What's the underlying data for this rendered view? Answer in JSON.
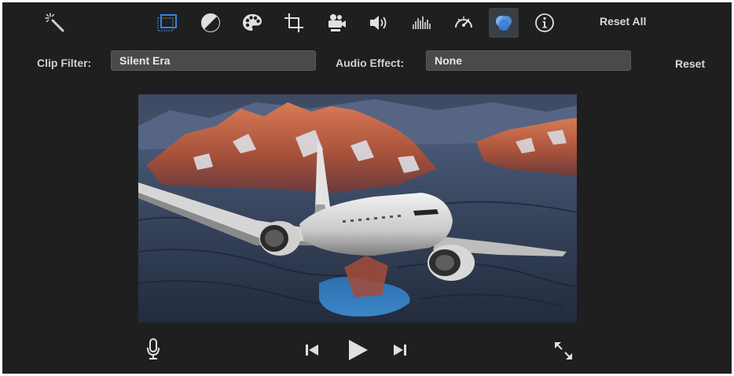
{
  "toolbar": {
    "tools": [
      {
        "id": "magic-wand",
        "icon": "magic-wand-icon"
      },
      {
        "id": "crop-frame",
        "icon": "crop-frame-icon",
        "state": "selected"
      },
      {
        "id": "color-balance",
        "icon": "color-balance-icon"
      },
      {
        "id": "color-correction",
        "icon": "palette-icon"
      },
      {
        "id": "crop",
        "icon": "crop-icon"
      },
      {
        "id": "stabilization",
        "icon": "video-camera-icon"
      },
      {
        "id": "volume",
        "icon": "speaker-icon"
      },
      {
        "id": "noise-reduction",
        "icon": "equalizer-icon"
      },
      {
        "id": "speed",
        "icon": "speedometer-icon"
      },
      {
        "id": "clip-filter",
        "icon": "filter-circles-icon",
        "state": "active"
      },
      {
        "id": "info",
        "icon": "info-icon"
      }
    ],
    "reset_all_label": "Reset All"
  },
  "filters": {
    "clip_filter_label": "Clip Filter:",
    "clip_filter_value": "Silent Era",
    "audio_effect_label": "Audio Effect:",
    "audio_effect_value": "None",
    "reset_label": "Reset"
  },
  "playback": {
    "controls": [
      "microphone-icon",
      "skip-back-icon",
      "play-icon",
      "skip-forward-icon",
      "fullscreen-icon"
    ]
  },
  "colors": {
    "background": "#1f1f1f",
    "field_bg": "#4a4a4a",
    "accent_blue": "#3d7fd9",
    "active_tool_bg": "#3a3e46"
  }
}
